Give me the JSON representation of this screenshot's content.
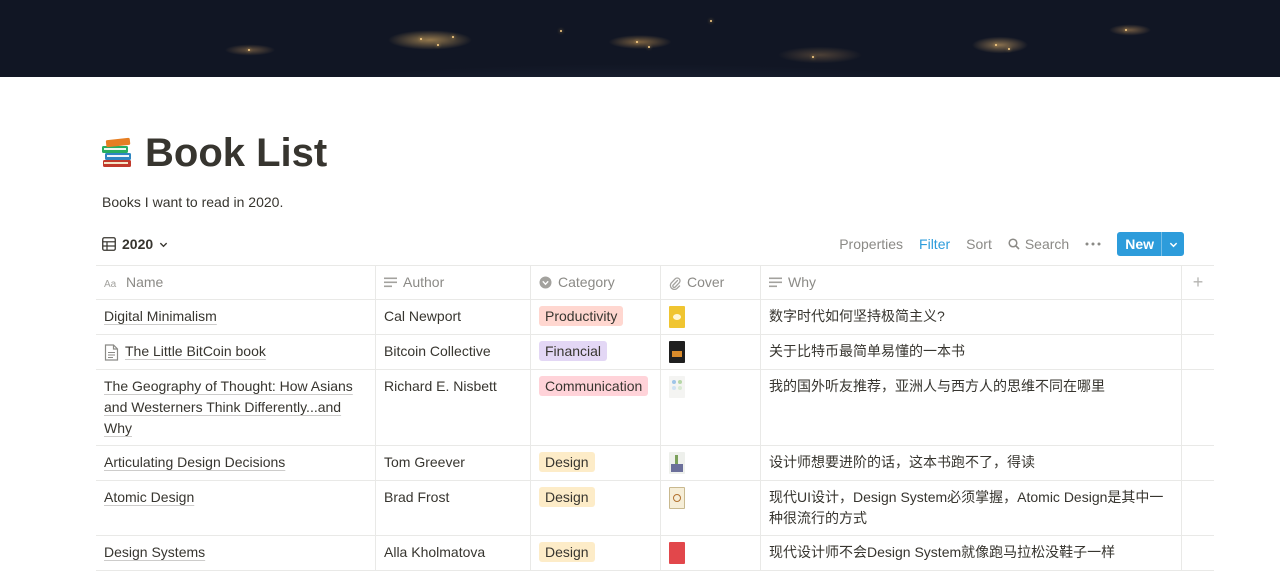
{
  "page": {
    "title": "Book List",
    "icon": "books-emoji-icon",
    "description": "Books I want to read in 2020."
  },
  "view": {
    "name": "2020"
  },
  "toolbar": {
    "properties": "Properties",
    "filter": "Filter",
    "sort": "Sort",
    "search": "Search",
    "new": "New"
  },
  "colors": {
    "accent": "#2d9cdb",
    "tag_productivity": "#ffd7d0",
    "tag_financial": "#e3d7f5",
    "tag_communication": "#ffd3d9",
    "tag_design": "#fdecc8"
  },
  "columns": {
    "name": "Name",
    "author": "Author",
    "category": "Category",
    "cover": "Cover",
    "why": "Why"
  },
  "rows": [
    {
      "name": "Digital Minimalism",
      "author": "Cal Newport",
      "category": "Productivity",
      "why": "数字时代如何坚持极简主义?"
    },
    {
      "name": "The Little BitCoin book",
      "author": "Bitcoin Collective",
      "category": "Financial",
      "why": "关于比特币最简单易懂的一本书"
    },
    {
      "name": "The Geography of Thought: How Asians and Westerners Think Differently...and Why",
      "author": "Richard E. Nisbett",
      "category": "Communication",
      "why": "我的国外听友推荐，亚洲人与西方人的思维不同在哪里"
    },
    {
      "name": "Articulating Design Decisions",
      "author": "Tom Greever",
      "category": "Design",
      "why": "设计师想要进阶的话，这本书跑不了，得读"
    },
    {
      "name": "Atomic Design",
      "author": "Brad Frost",
      "category": "Design",
      "why": "现代UI设计，Design System必须掌握，Atomic Design是其中一种很流行的方式"
    },
    {
      "name": "Design Systems",
      "author": "Alla Kholmatova",
      "category": "Design",
      "why": "现代设计师不会Design System就像跑马拉松没鞋子一样"
    }
  ]
}
